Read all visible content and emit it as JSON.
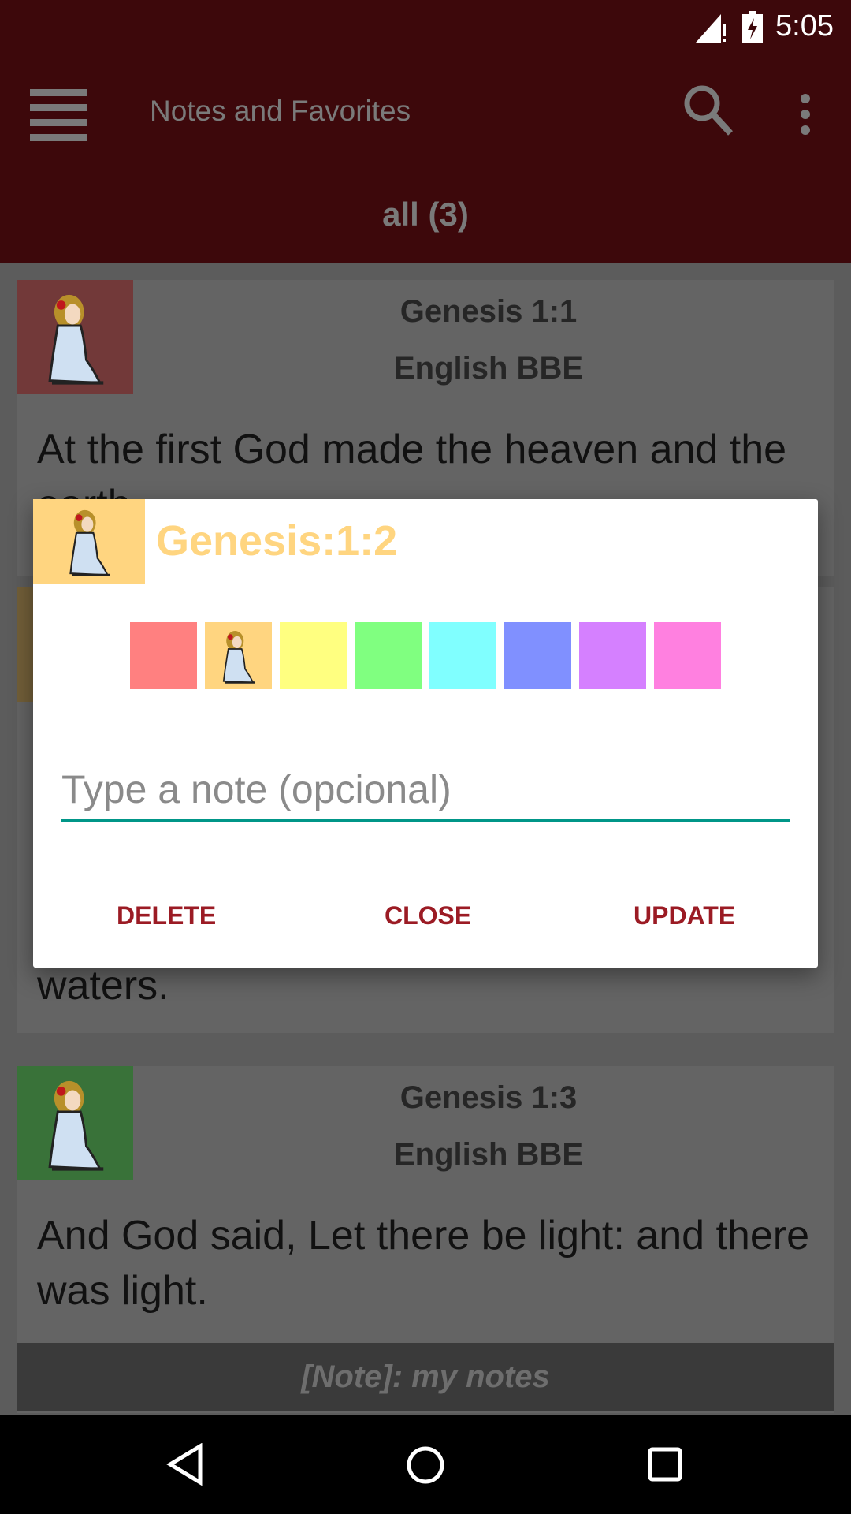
{
  "status_bar": {
    "time": "5:05",
    "icons": [
      "signal-alert-icon",
      "battery-charging-icon"
    ]
  },
  "app_bar": {
    "title": "Notes and Favorites",
    "menu_icon": "hamburger-menu-icon",
    "search_icon": "search-icon",
    "more_icon": "more-vertical-icon"
  },
  "tab": {
    "label": "all (3)"
  },
  "cards": [
    {
      "reference": "Genesis 1:1",
      "version": "English BBE",
      "text": " At the first God made the heaven and the earth.",
      "color": "#ff8080"
    },
    {
      "text": "waters.",
      "color": "#ffd580"
    },
    {
      "reference": "Genesis 1:3",
      "version": "English BBE",
      "text": " And God said, Let there be light: and there was light.",
      "note": "[Note]: my notes",
      "color": "#80ff80"
    }
  ],
  "dialog": {
    "title": "Genesis:1:2",
    "selected_color": "#ffd580",
    "colors": [
      "#ff8080",
      "#ffd580",
      "#ffff80",
      "#80ff80",
      "#80ffff",
      "#8090ff",
      "#d580ff",
      "#ff80e0"
    ],
    "note_placeholder": "Type a note (opcional)",
    "note_value": "",
    "buttons": {
      "delete": "DELETE",
      "close": "CLOSE",
      "update": "UPDATE"
    }
  },
  "accent": {
    "primary": "#8b1a1f",
    "button_text": "#9b1b24",
    "input_underline": "#009688"
  }
}
